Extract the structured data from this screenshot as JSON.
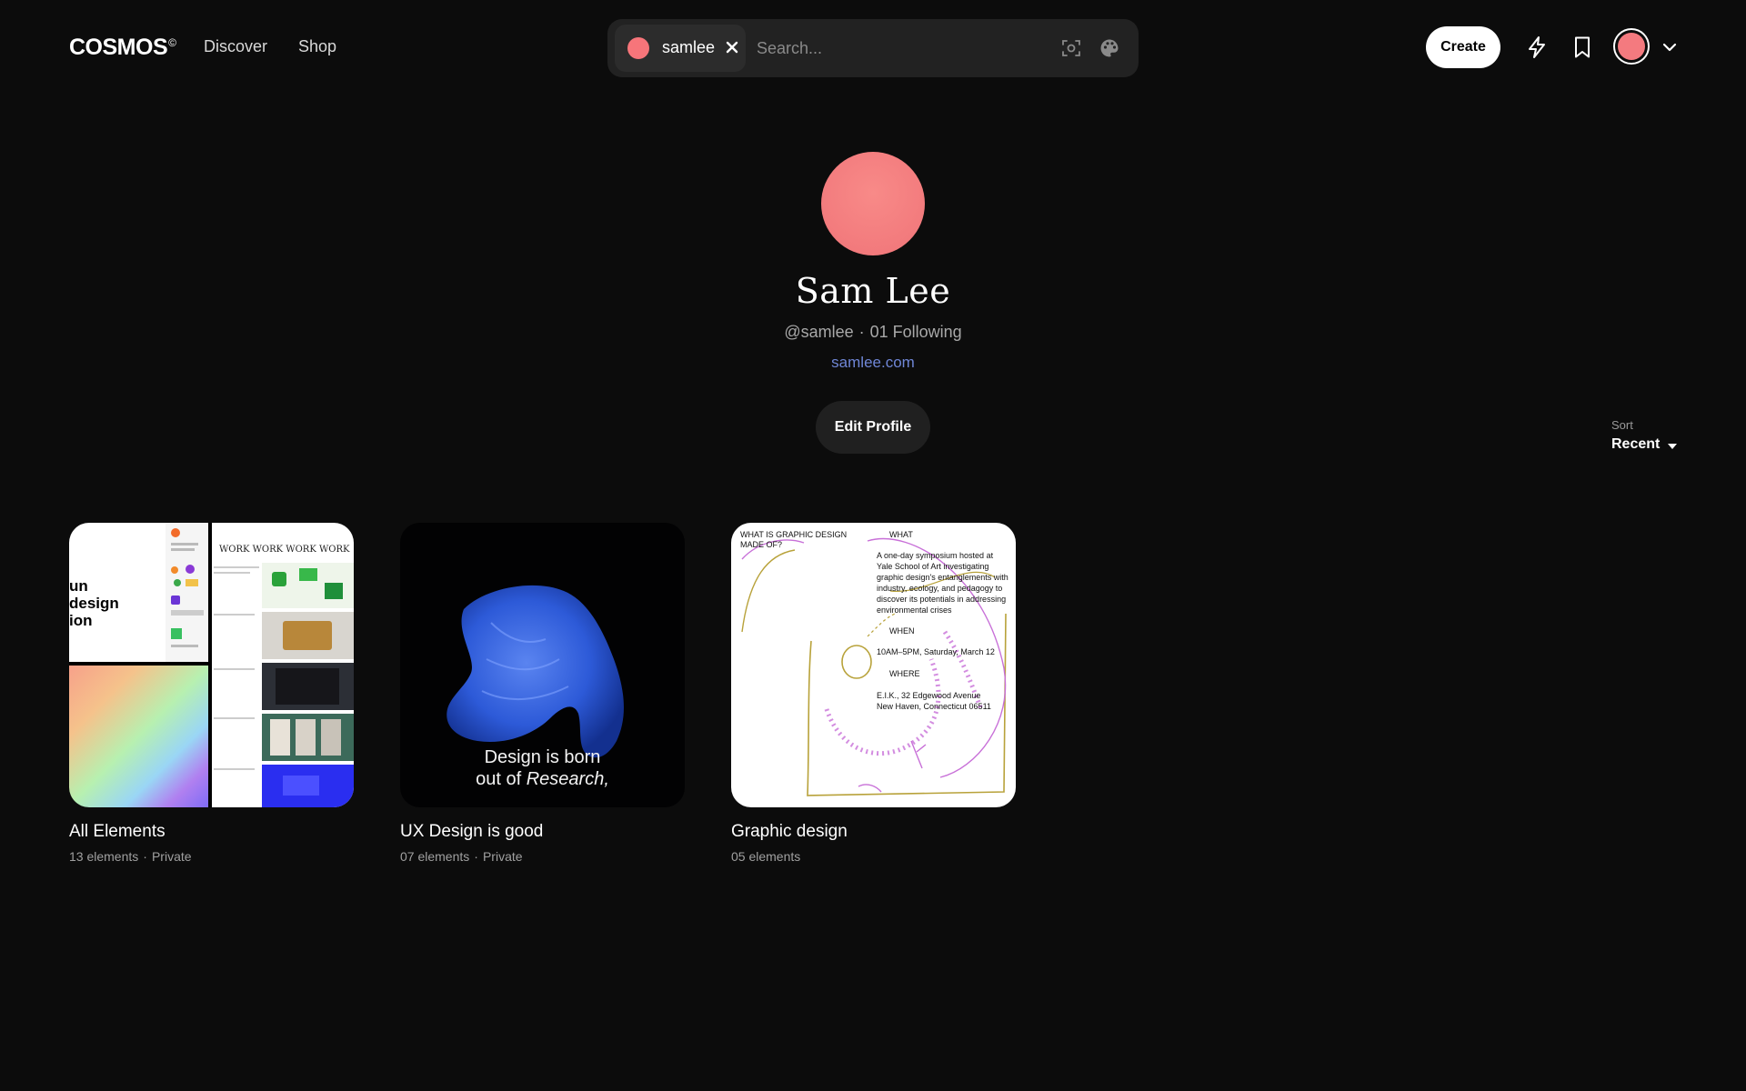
{
  "nav": {
    "logo": "COSMOS",
    "logo_mark": "©",
    "links": [
      "Discover",
      "Shop"
    ],
    "create_label": "Create"
  },
  "search": {
    "chip_label": "samlee",
    "placeholder": "Search..."
  },
  "profile": {
    "name": "Sam Lee",
    "handle": "@samlee",
    "separator": "·",
    "following": "01 Following",
    "website": "samlee.com",
    "edit_label": "Edit Profile",
    "avatar_color": "#f47a7f"
  },
  "sort": {
    "label": "Sort",
    "value": "Recent"
  },
  "boards": [
    {
      "title": "All Elements",
      "count": "13 elements",
      "visibility": "Private",
      "thumb_text": [
        "un",
        "design",
        "ion"
      ],
      "thumb_banner": "WORK WORK WORK WORK WORK"
    },
    {
      "title": "UX Design is good",
      "count": "07 elements",
      "visibility": "Private",
      "caption_line1": "Design is born",
      "caption_line2_prefix": "out of ",
      "caption_line2_em": "Research,"
    },
    {
      "title": "Graphic design",
      "count": "05 elements",
      "visibility": "",
      "poster": {
        "heading": "WHAT IS GRAPHIC DESIGN MADE OF?",
        "what_label": "WHAT",
        "what_text": "A one-day symposium hosted at Yale School of Art investigating graphic design's entanglements with industry, ecology, and pedagogy to discover its potentials in addressing environmental crises",
        "when_label": "WHEN",
        "when_text": "10AM–5PM, Saturday, March 12",
        "where_label": "WHERE",
        "where_line1": "E.I.K., 32 Edgewood Avenue",
        "where_line2": "New Haven, Connecticut 06511"
      }
    }
  ],
  "colors": {
    "background": "#0c0c0c",
    "accent_link": "#6f86d6",
    "avatar": "#f47a7f"
  }
}
